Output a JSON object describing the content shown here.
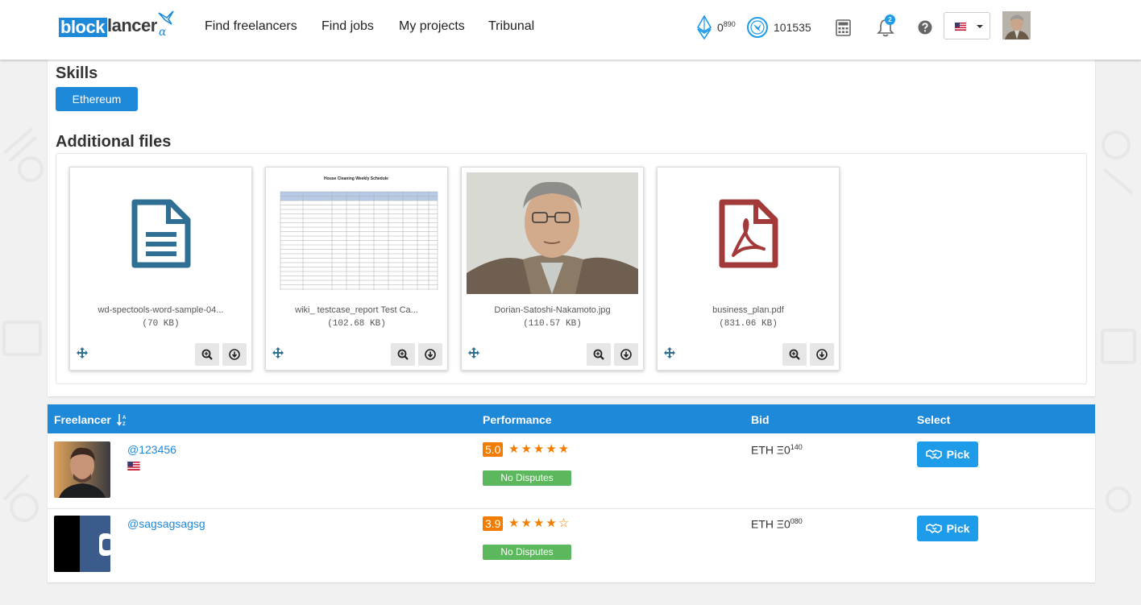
{
  "header": {
    "logo_block": "block",
    "logo_lancer": "lancer",
    "logo_alpha": "α",
    "nav": [
      {
        "label": "Find freelancers"
      },
      {
        "label": "Find jobs"
      },
      {
        "label": "My projects"
      },
      {
        "label": "Tribunal"
      }
    ],
    "eth_balance_main": "0",
    "eth_balance_sup": "890",
    "token_balance": "101535",
    "notification_count": "2",
    "language": "en-US"
  },
  "skills": {
    "title": "Skills",
    "items": [
      "Ethereum"
    ]
  },
  "files": {
    "title": "Additional files",
    "items": [
      {
        "name": "wd-spectools-word-sample-04...",
        "size": "(70 KB)",
        "type": "document"
      },
      {
        "name": "wiki_ testcase_report Test Ca...",
        "size": "(102.68 KB)",
        "type": "spreadsheet-image"
      },
      {
        "name": "Dorian-Satoshi-Nakamoto.jpg",
        "size": "(110.57 KB)",
        "type": "photo"
      },
      {
        "name": "business_plan.pdf",
        "size": "(831.06 KB)",
        "type": "pdf"
      }
    ],
    "thumb_sheet_title": "House Cleaning Weekly Schedule"
  },
  "table": {
    "headers": {
      "freelancer": "Freelancer",
      "performance": "Performance",
      "bid": "Bid",
      "select": "Select"
    },
    "rows": [
      {
        "handle": "@123456",
        "score": "5.0",
        "stars": "★★★★★",
        "disputes": "No Disputes",
        "bid_currency": "ETH Ξ0",
        "bid_sup": "140",
        "pick_label": "Pick"
      },
      {
        "handle": "@sagsagsagsg",
        "score": "3.9",
        "stars": "★★★★☆",
        "disputes": "No Disputes",
        "bid_currency": "ETH Ξ0",
        "bid_sup": "080",
        "pick_label": "Pick"
      }
    ]
  },
  "colors": {
    "brand_blue": "#1e88d9",
    "accent_orange": "#f27d00",
    "success_green": "#5cb85c",
    "doc_icon": "#2f6f93",
    "pdf_icon": "#a33a3a"
  }
}
